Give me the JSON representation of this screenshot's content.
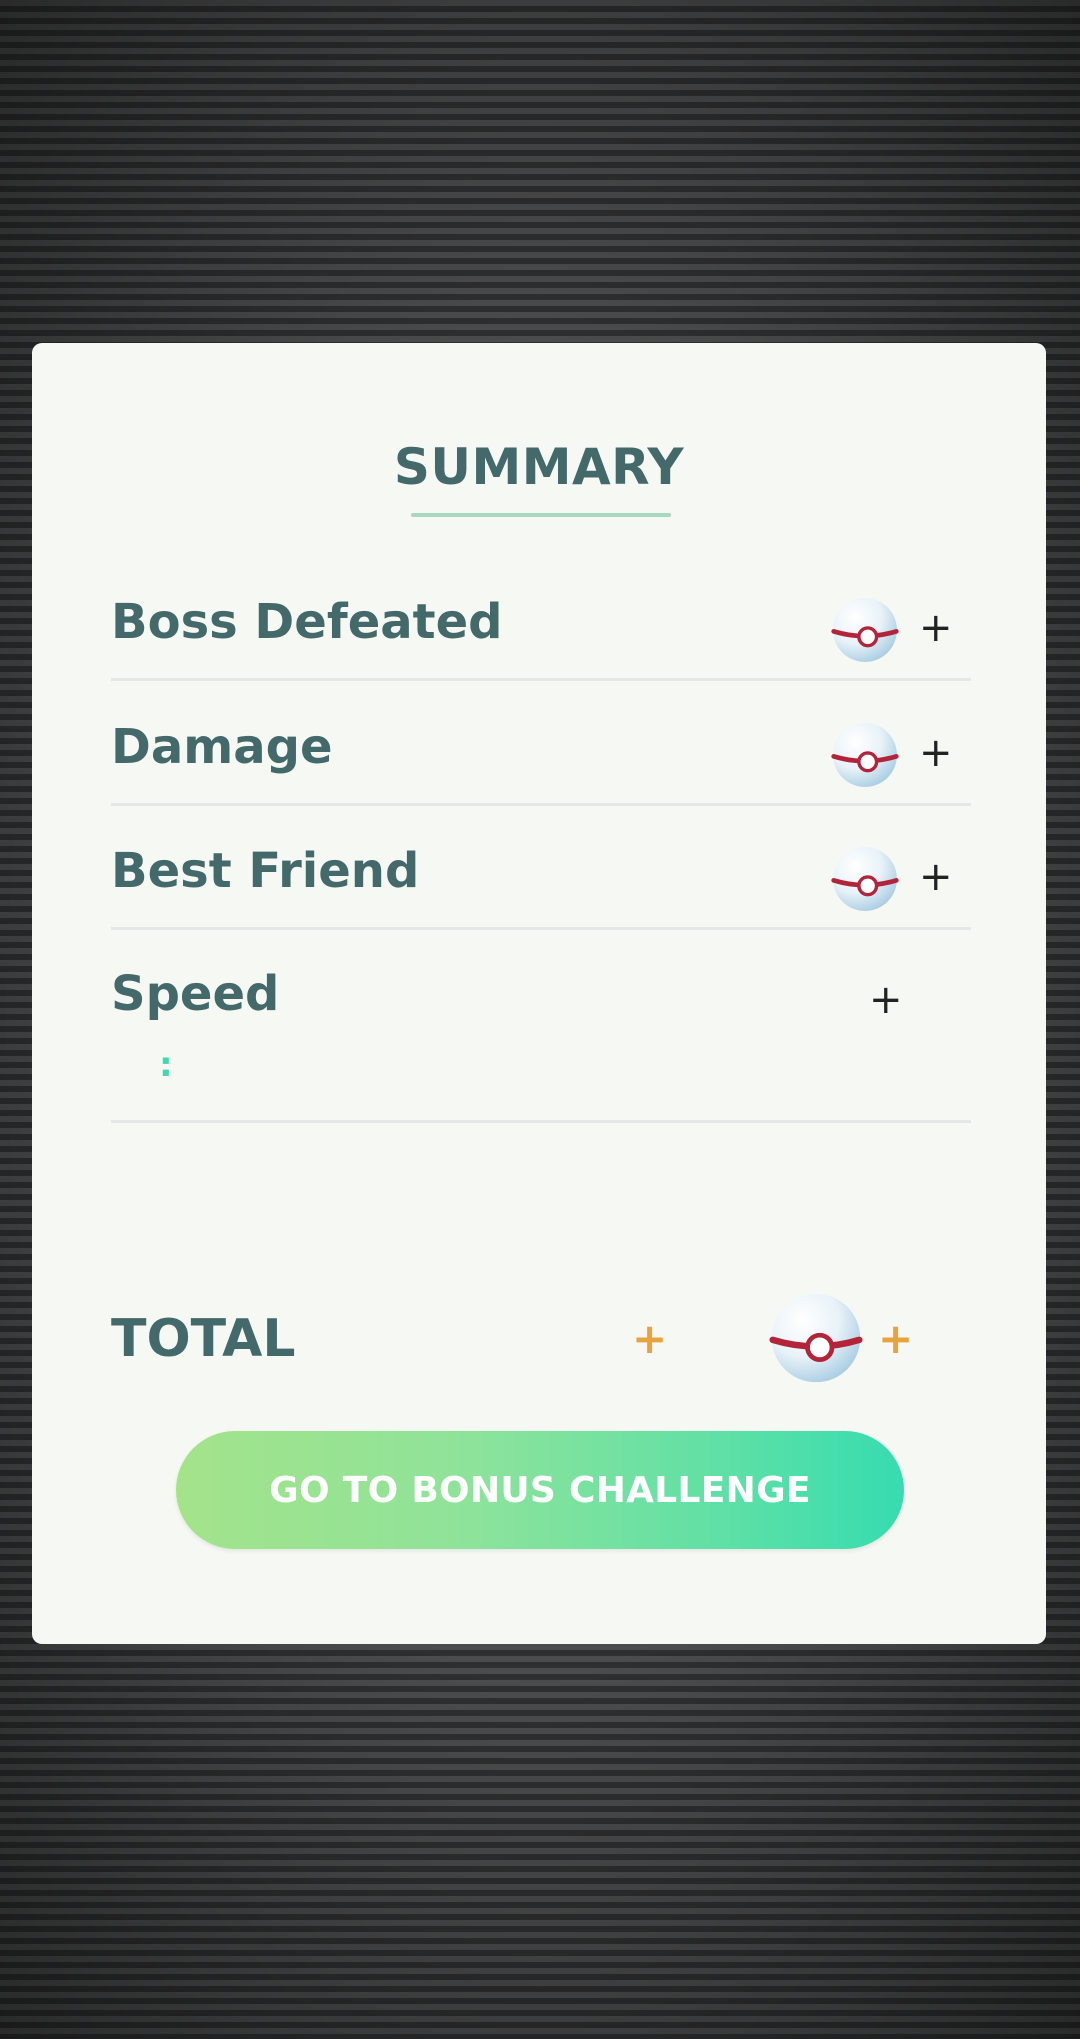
{
  "summary": {
    "title": "SUMMARY",
    "rows": [
      {
        "label": "Boss Defeated",
        "bonus": "+"
      },
      {
        "label": "Damage",
        "bonus": "+"
      },
      {
        "label": "Best Friend",
        "bonus": "+"
      },
      {
        "label": "Speed",
        "bonus": "+",
        "sub": ":"
      }
    ],
    "total": {
      "label": "TOTAL",
      "bonus_left": "+",
      "bonus_right": "+"
    },
    "button_label": "GO TO BONUS CHALLENGE"
  },
  "icons": {
    "reward": "premier-ball-icon"
  },
  "colors": {
    "label_text": "#44696a",
    "title_underline": "#a8d8c0",
    "total_plus": "#e8a33d",
    "button_gradient_start": "#a4e38a",
    "button_gradient_end": "#36dcb0",
    "card_background": "#f6f8f4"
  }
}
